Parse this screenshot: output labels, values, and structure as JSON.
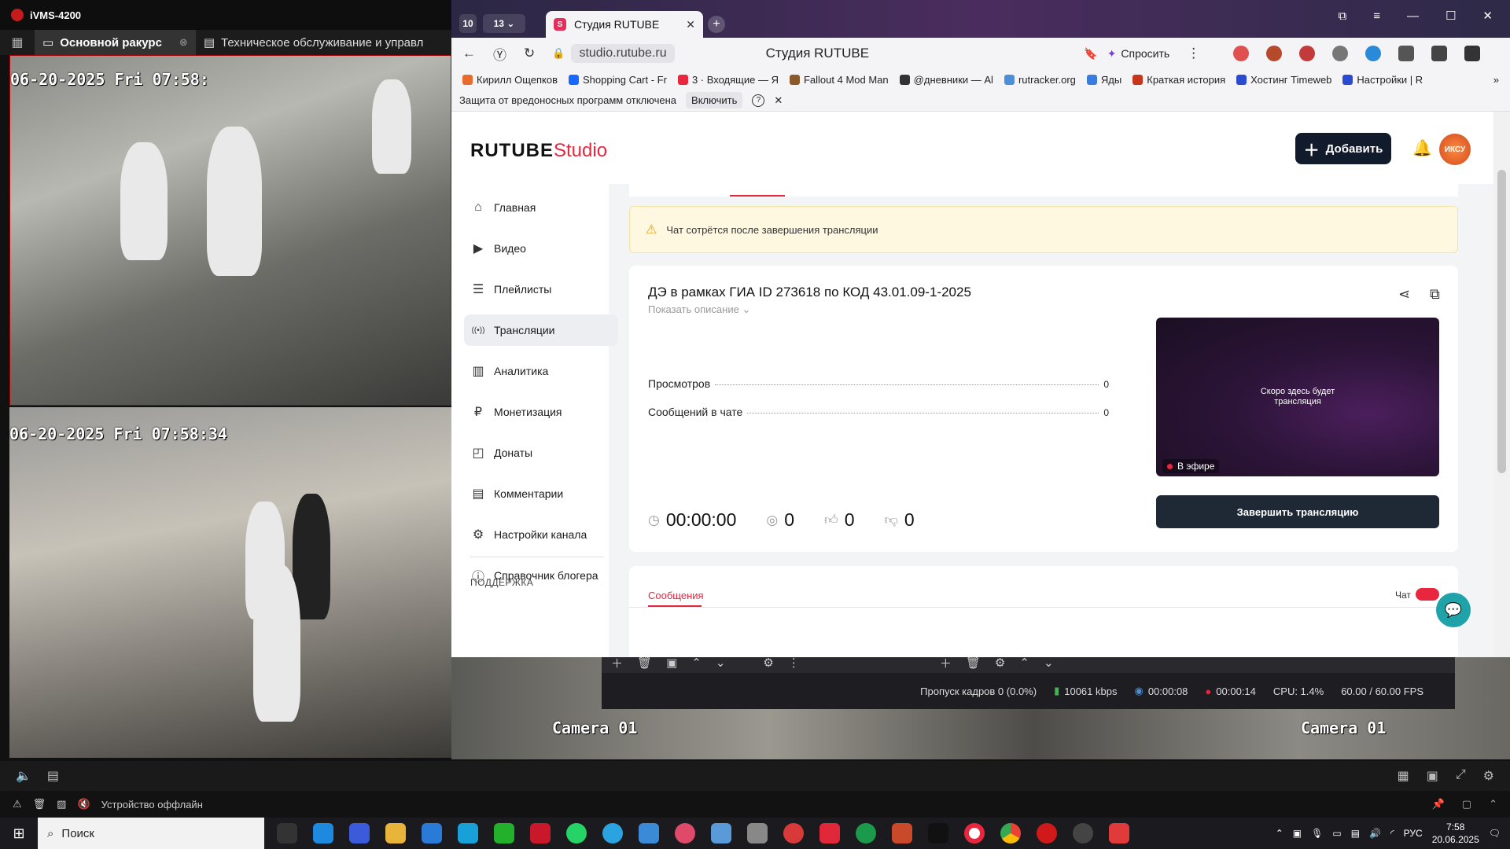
{
  "ivms": {
    "app_title": "iVMS-4200",
    "tab_main": "Основной ракурс",
    "tab_maint": "Техническое обслуживание и управл",
    "cam1_osd": "06-20-2025 Fri 07:58:",
    "cam2_osd": "06-20-2025 Fri 07:58:34",
    "cam_label_a": "Camera 01",
    "cam_label_b": "Camera 01",
    "device_status": "Устройство оффлайн"
  },
  "obs": {
    "dropped": "Пропуск кадров 0 (0.0%)",
    "bitrate": "10061 kbps",
    "time1": "00:00:08",
    "time2": "00:00:14",
    "cpu": "CPU: 1.4%",
    "fps": "60.00 / 60.00 FPS"
  },
  "browser": {
    "tab_count_a": "10",
    "tab_count_b": "13",
    "tab_title": "Студия RUTUBE",
    "url_host": "studio.rutube.ru",
    "page_title": "Студия RUTUBE",
    "ask_label": "Спросить",
    "bookmarks": [
      {
        "label": "Кирилл Ощепков",
        "color": "#e86a2c"
      },
      {
        "label": "Shopping Cart - Fr",
        "color": "#1769ff"
      },
      {
        "label": "3 · Входящие — Я",
        "color": "#e8263e"
      },
      {
        "label": "Fallout 4 Mod Man",
        "color": "#8a5a2b"
      },
      {
        "label": "@дневники — Al",
        "color": "#333333"
      },
      {
        "label": "rutracker.org",
        "color": "#4a8fd8"
      },
      {
        "label": "Яды",
        "color": "#3a7be0"
      },
      {
        "label": "Краткая история",
        "color": "#c7361b"
      },
      {
        "label": "Хостинг Timeweb",
        "color": "#2a4bd0"
      },
      {
        "label": "Настройки | R",
        "color": "#2a4bd0"
      }
    ],
    "infobar_text": "Защита от вредоносных программ отключена",
    "infobar_button": "Включить",
    "infobar_help": "?"
  },
  "studio": {
    "logo_main": "RUTUBE",
    "logo_studio": "Studio",
    "add_button": "Добавить",
    "avatar_text": "ИКСУ",
    "nav": [
      {
        "label": "Главная",
        "icon": "⌂"
      },
      {
        "label": "Видео",
        "icon": "▶"
      },
      {
        "label": "Плейлисты",
        "icon": "☰"
      },
      {
        "label": "Трансляции",
        "icon": "((•))"
      },
      {
        "label": "Аналитика",
        "icon": "▥"
      },
      {
        "label": "Монетизация",
        "icon": "₽"
      },
      {
        "label": "Донаты",
        "icon": "◰"
      },
      {
        "label": "Комментарии",
        "icon": "▤"
      },
      {
        "label": "Настройки канала",
        "icon": "⚙"
      },
      {
        "label": "Справочник блогера",
        "icon": "ⓘ"
      }
    ],
    "support_label": "ПОДДЕРЖКА",
    "warning": "Чат сотрётся после завершения трансляции",
    "stream_title": "ДЭ в рамках ГИА ID 273618 по КОД 43.01.09-1-2025",
    "show_description": "Показать описание",
    "stats": [
      {
        "label": "Просмотров",
        "value": "0"
      },
      {
        "label": "Сообщений в чате",
        "value": "0"
      }
    ],
    "metrics": {
      "duration": "00:00:00",
      "viewers": "0",
      "likes": "0",
      "dislikes": "0"
    },
    "preview_text_1": "Скоро здесь будет",
    "preview_text_2": "трансляция",
    "on_air": "В эфире",
    "finish_button": "Завершить трансляцию",
    "messages_tab": "Сообщения",
    "chat_label": "Чат"
  },
  "taskbar": {
    "search_placeholder": "Поиск",
    "lang": "РУС",
    "time": "7:58",
    "date": "20.06.2025"
  }
}
